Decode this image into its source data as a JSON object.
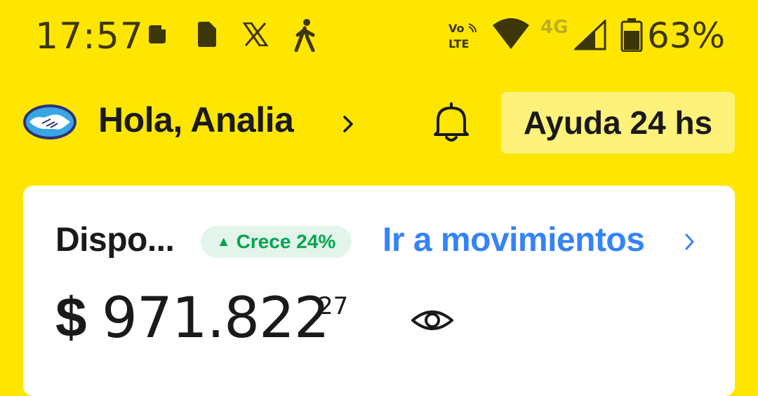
{
  "status_bar": {
    "time": "17:57",
    "battery_percent": "63%",
    "network_label": "4G",
    "volte_label": "Vo LTE",
    "icons": [
      "message-icon",
      "sim-icon",
      "x-app-icon",
      "walking-icon",
      "volte-icon",
      "wifi-icon",
      "signal-icon",
      "battery-icon"
    ]
  },
  "header": {
    "greeting": "Hola, Analia",
    "help_label": "Ayuda 24 hs",
    "icons": [
      "mercadopago-handshake-logo",
      "chevron-right-icon",
      "bell-icon"
    ]
  },
  "balance_card": {
    "title": "Dispo...",
    "growth_badge": "Crece 24%",
    "growth_arrow": "▲",
    "movements_link": "Ir a movimientos",
    "currency": "$",
    "amount": "971.822",
    "cents": "27",
    "icons": [
      "chevron-right-icon",
      "eye-icon"
    ]
  },
  "colors": {
    "brand_yellow": "#FFE600",
    "help_button_bg": "#FFF27A",
    "link_blue": "#3483FA",
    "badge_green": "#00A650",
    "badge_bg": "#E3F5EA",
    "status_text": "#3d3608"
  }
}
